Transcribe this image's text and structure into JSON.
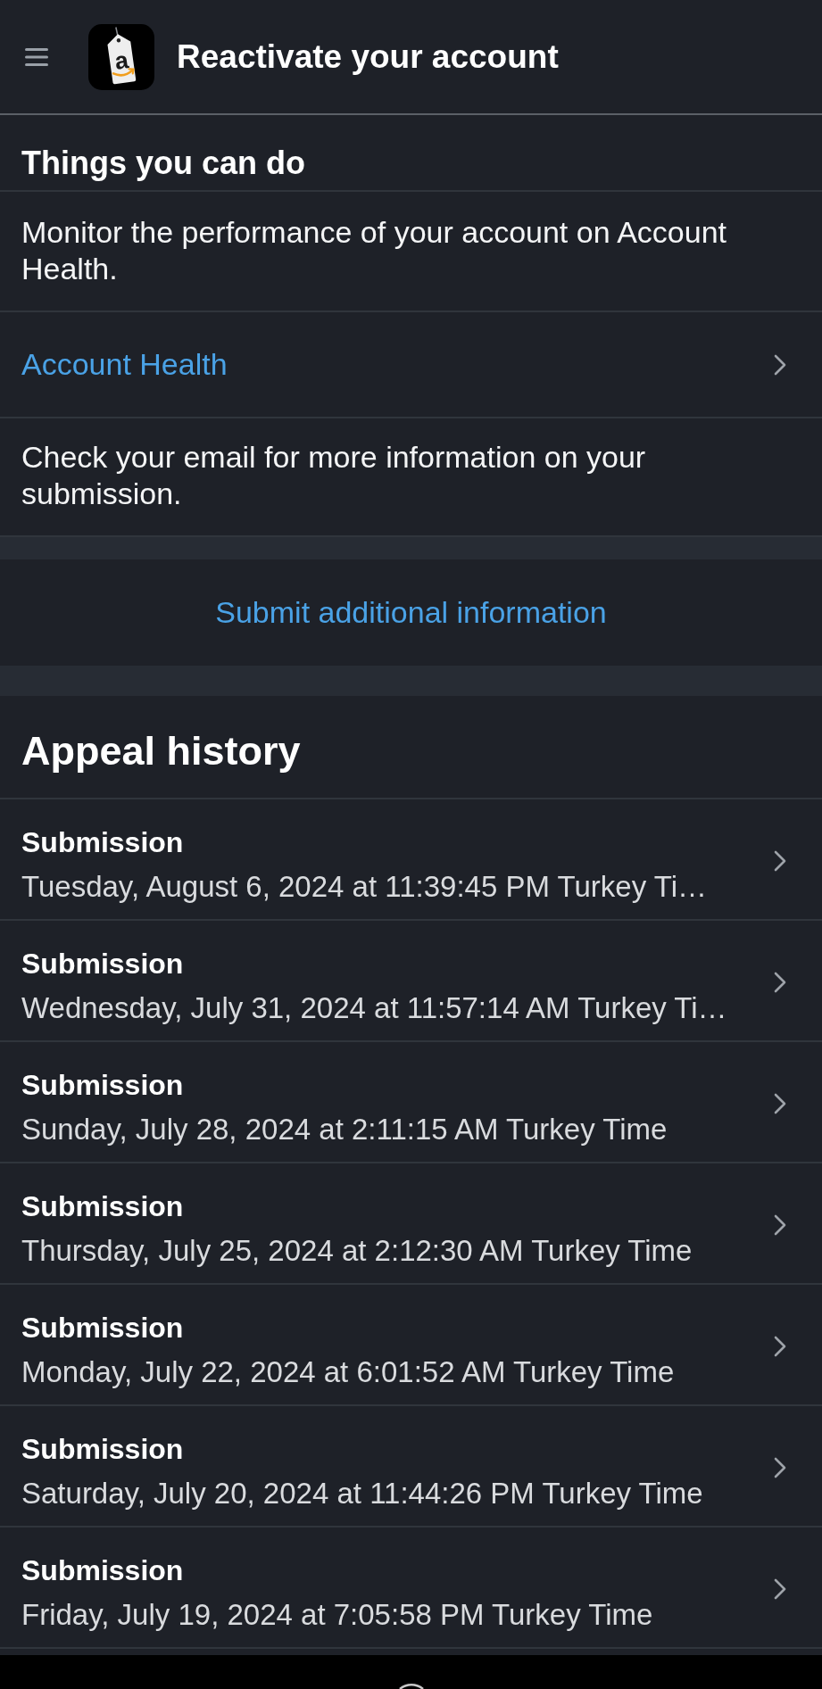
{
  "header": {
    "logo_letter": "a",
    "title": "Reactivate your account"
  },
  "things_you_can_do": {
    "title": "Things you can do",
    "items": [
      {
        "kind": "text",
        "text": "Monitor the performance of your account on Account Health."
      },
      {
        "kind": "link",
        "text": "Account Health"
      },
      {
        "kind": "text",
        "text": "Check your email for more information on your submission."
      }
    ]
  },
  "submit_link": "Submit additional information",
  "appeal_history": {
    "title": "Appeal history",
    "submissions": [
      {
        "title": "Submission",
        "date": "Tuesday, August 6, 2024 at 11:39:45 PM Turkey Ti…"
      },
      {
        "title": "Submission",
        "date": "Wednesday, July 31, 2024 at 11:57:14 AM Turkey Ti…"
      },
      {
        "title": "Submission",
        "date": "Sunday, July 28, 2024 at 2:11:15 AM Turkey Time"
      },
      {
        "title": "Submission",
        "date": "Thursday, July 25, 2024 at 2:12:30 AM Turkey Time"
      },
      {
        "title": "Submission",
        "date": "Monday, July 22, 2024 at 6:01:52 AM Turkey Time"
      },
      {
        "title": "Submission",
        "date": "Saturday, July 20, 2024 at 11:44:26 PM Turkey Time"
      },
      {
        "title": "Submission",
        "date": "Friday, July 19, 2024 at 7:05:58 PM Turkey Time"
      }
    ]
  }
}
